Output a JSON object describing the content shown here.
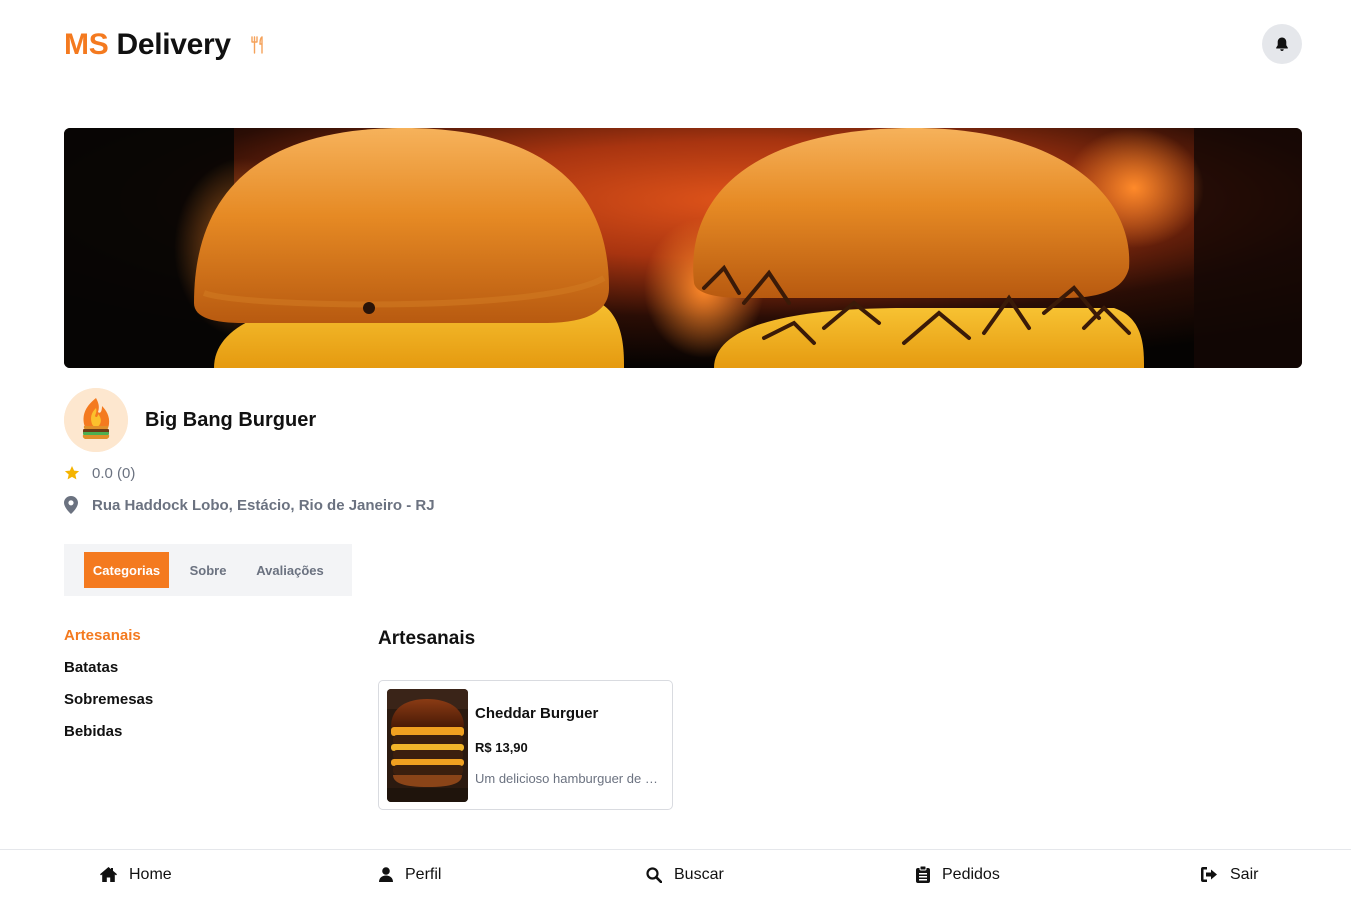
{
  "brand": {
    "prefix": "MS",
    "name": "Delivery",
    "accent_color": "#f47a1f"
  },
  "header": {
    "notification_icon": "bell-icon",
    "logo_icon": "utensils-icon"
  },
  "store": {
    "name": "Big Bang Burguer",
    "rating": "0.0 (0)",
    "address": "Rua Haddock Lobo, Estácio, Rio de Janeiro - RJ"
  },
  "tabs": [
    {
      "label": "Categorias",
      "active": true
    },
    {
      "label": "Sobre",
      "active": false
    },
    {
      "label": "Avaliações",
      "active": false
    }
  ],
  "categories": [
    {
      "label": "Artesanais",
      "active": true
    },
    {
      "label": "Batatas",
      "active": false
    },
    {
      "label": "Sobremesas",
      "active": false
    },
    {
      "label": "Bebidas",
      "active": false
    }
  ],
  "section": {
    "title": "Artesanais"
  },
  "products": [
    {
      "name": "Cheddar Burguer",
      "price": "R$ 13,90",
      "description": "Um delicioso hamburguer de carne com cheddar"
    }
  ],
  "bottom_nav": [
    {
      "label": "Home",
      "icon": "home-icon"
    },
    {
      "label": "Perfil",
      "icon": "user-icon"
    },
    {
      "label": "Buscar",
      "icon": "search-icon"
    },
    {
      "label": "Pedidos",
      "icon": "clipboard-icon"
    },
    {
      "label": "Sair",
      "icon": "sign-out-icon"
    }
  ]
}
